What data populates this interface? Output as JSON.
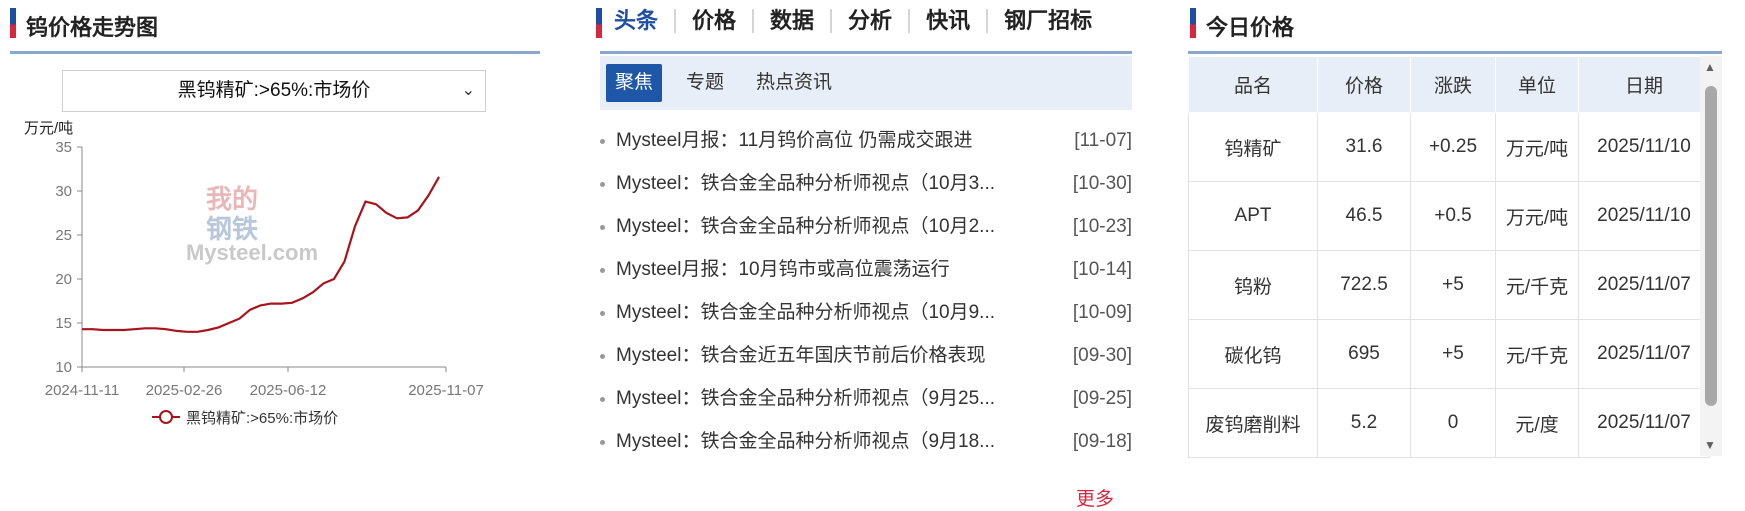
{
  "chart_panel": {
    "title": "钨价格走势图",
    "select_value": "黑钨精矿:>65%:市场价"
  },
  "chart_data": {
    "type": "line",
    "ylabel": "万元/吨",
    "ylim": [
      10,
      35
    ],
    "yticks": [
      10,
      15,
      20,
      25,
      30,
      35
    ],
    "xticks": [
      "2024-11-11",
      "2025-02-26",
      "2025-06-12",
      "2025-11-07"
    ],
    "legend": "黑钨精矿:>65%:市场价",
    "series": [
      {
        "name": "黑钨精矿:>65%:市场价",
        "values": [
          14.3,
          14.3,
          14.2,
          14.2,
          14.2,
          14.3,
          14.4,
          14.4,
          14.3,
          14.1,
          14.0,
          14.0,
          14.2,
          14.5,
          15.0,
          15.5,
          16.5,
          17.0,
          17.2,
          17.2,
          17.3,
          17.8,
          18.5,
          19.5,
          20.0,
          22.0,
          26.0,
          28.8,
          28.5,
          27.5,
          26.9,
          27.0,
          27.8,
          29.5,
          31.6
        ]
      }
    ],
    "line_color": "#a8141b",
    "watermark": [
      "我的",
      "钢铁",
      "Mysteel.com"
    ]
  },
  "news_panel": {
    "tabs": [
      "头条",
      "价格",
      "数据",
      "分析",
      "快讯",
      "钢厂招标"
    ],
    "subtabs": [
      "聚焦",
      "专题",
      "热点资讯"
    ],
    "items": [
      {
        "title": "Mysteel月报：11月钨价高位 仍需成交跟进",
        "date": "[11-07]"
      },
      {
        "title": "Mysteel：铁合金全品种分析师视点（10月3...",
        "date": "[10-30]"
      },
      {
        "title": "Mysteel：铁合金全品种分析师视点（10月2...",
        "date": "[10-23]"
      },
      {
        "title": "Mysteel月报：10月钨市或高位震荡运行",
        "date": "[10-14]"
      },
      {
        "title": "Mysteel：铁合金全品种分析师视点（10月9...",
        "date": "[10-09]"
      },
      {
        "title": "Mysteel：铁合金近五年国庆节前后价格表现",
        "date": "[09-30]"
      },
      {
        "title": "Mysteel：铁合金全品种分析师视点（9月25...",
        "date": "[09-25]"
      },
      {
        "title": "Mysteel：铁合金全品种分析师视点（9月18...",
        "date": "[09-18]"
      }
    ],
    "more": "更多"
  },
  "price_panel": {
    "title": "今日价格",
    "headers": [
      "品名",
      "价格",
      "涨跌",
      "单位",
      "日期"
    ],
    "rows": [
      [
        "钨精矿",
        "31.6",
        "+0.25",
        "万元/吨",
        "2025/11/10"
      ],
      [
        "APT",
        "46.5",
        "+0.5",
        "万元/吨",
        "2025/11/10"
      ],
      [
        "钨粉",
        "722.5",
        "+5",
        "元/千克",
        "2025/11/07"
      ],
      [
        "碳化钨",
        "695",
        "+5",
        "元/千克",
        "2025/11/07"
      ],
      [
        "废钨磨削料",
        "5.2",
        "0",
        "元/度",
        "2025/11/07"
      ]
    ]
  }
}
